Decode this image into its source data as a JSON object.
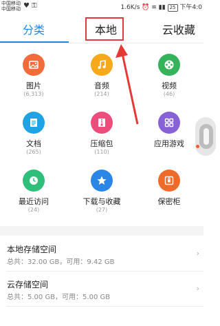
{
  "statusbar": {
    "carrier_1": "中国移动",
    "carrier_2": "中国移动",
    "speed": "1.6K/s",
    "battery": "25",
    "time": "下午4:0"
  },
  "tabs": [
    {
      "label": "分类"
    },
    {
      "label": "本地"
    },
    {
      "label": "云收藏"
    }
  ],
  "categories": [
    {
      "label": "图片",
      "count": "(6,313)",
      "icon": "image-icon",
      "color": "#f26b3a"
    },
    {
      "label": "音频",
      "count": "(214)",
      "icon": "music-icon",
      "color": "#f7a81b"
    },
    {
      "label": "视频",
      "count": "(46)",
      "icon": "film-reel-icon",
      "color": "#35b35a"
    },
    {
      "label": "文档",
      "count": "(265)",
      "icon": "document-icon",
      "color": "#1fa3e4"
    },
    {
      "label": "压缩包",
      "count": "(110)",
      "icon": "zip-icon",
      "color": "#ec4d7a"
    },
    {
      "label": "应用游戏",
      "count": "",
      "icon": "apps-grid-icon",
      "color": "#8761d6"
    },
    {
      "label": "最近访问",
      "count": "(24)",
      "icon": "clock-icon",
      "color": "#2fbf7a"
    },
    {
      "label": "下载与收藏",
      "count": "(27)",
      "icon": "star-icon",
      "color": "#2b87e6"
    },
    {
      "label": "保密柜",
      "count": "",
      "icon": "safe-icon",
      "color": "#f06b2a"
    }
  ],
  "storage": [
    {
      "title": "本地存储空间",
      "detail": "总共：32.00 GB，可用：9.42 GB"
    },
    {
      "title": "云存储空间",
      "detail": "总共：5.00 GB，可用：5.00 GB"
    }
  ],
  "colors": {
    "accent": "#1f86e6",
    "highlight": "#e03a3a"
  }
}
